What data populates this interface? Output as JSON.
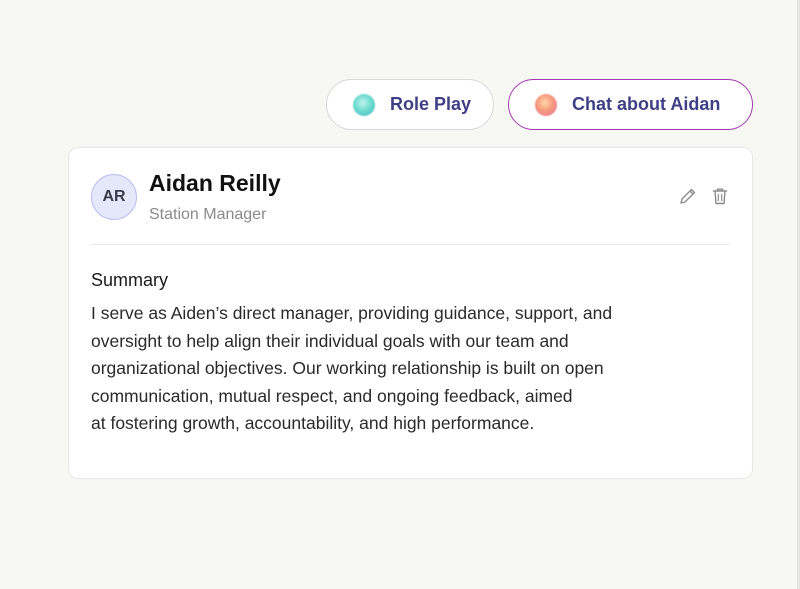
{
  "actions": {
    "role_play_label": "Role Play",
    "chat_label": "Chat about Aidan"
  },
  "profile": {
    "initials": "AR",
    "name": "Aidan Reilly",
    "title": "Station Manager"
  },
  "summary": {
    "heading": "Summary",
    "lines": [
      "I serve as Aiden’s direct manager, providing guidance, support, and",
      "oversight to help align their individual goals with our team and",
      "organizational objectives. Our working relationship is built on open",
      "communication, mutual respect, and ongoing feedback, aimed",
      "at fostering growth, accountability, and high performance."
    ]
  },
  "icons": {
    "role_play": "teal-orb-icon",
    "chat": "warm-orb-icon",
    "edit": "pencil-icon",
    "delete": "trash-icon"
  },
  "colors": {
    "chat_border": "#a33bb0",
    "button_text": "#3f3f86",
    "avatar_bg": "#e5e7fb"
  }
}
